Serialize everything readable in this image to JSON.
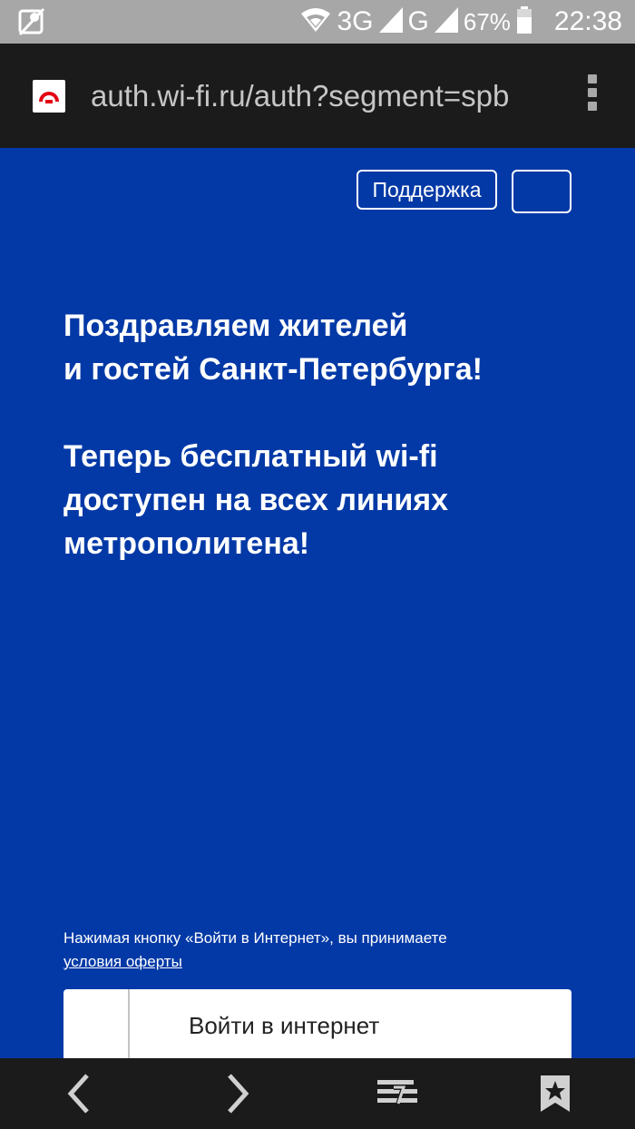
{
  "status_bar": {
    "network_3g": "3G",
    "network_g": "G",
    "battery": "67%",
    "time": "22:38"
  },
  "browser": {
    "url": "auth.wi-fi.ru/auth?segment=spb"
  },
  "header": {
    "support_label": "Поддержка"
  },
  "main": {
    "headline_1": "Поздравляем жителей",
    "headline_2": "и гостей Санкт-Петербурга!",
    "headline_3": "Теперь бесплатный wi-fi",
    "headline_4": "доступен на всех линиях",
    "headline_5": "метрополитена!",
    "terms_text": "Нажимая кнопку «Войти в Интернет», вы принимаете",
    "terms_link": "условия оферты",
    "login_label": "Войти в интернет"
  },
  "icons": {
    "status_left": "location-off-icon",
    "wifi": "wifi-icon",
    "signal": "signal-icon",
    "battery": "battery-icon",
    "menu": "more-vert-icon",
    "back": "chevron-left-icon",
    "forward": "chevron-right-icon",
    "tabs": "tabs-icon",
    "bookmark": "bookmark-star-icon"
  },
  "colors": {
    "background": "#0339a6",
    "status_bar": "#a7a7a7",
    "browser_chrome": "#1b1b1b",
    "favicon_accent": "#e30613"
  }
}
